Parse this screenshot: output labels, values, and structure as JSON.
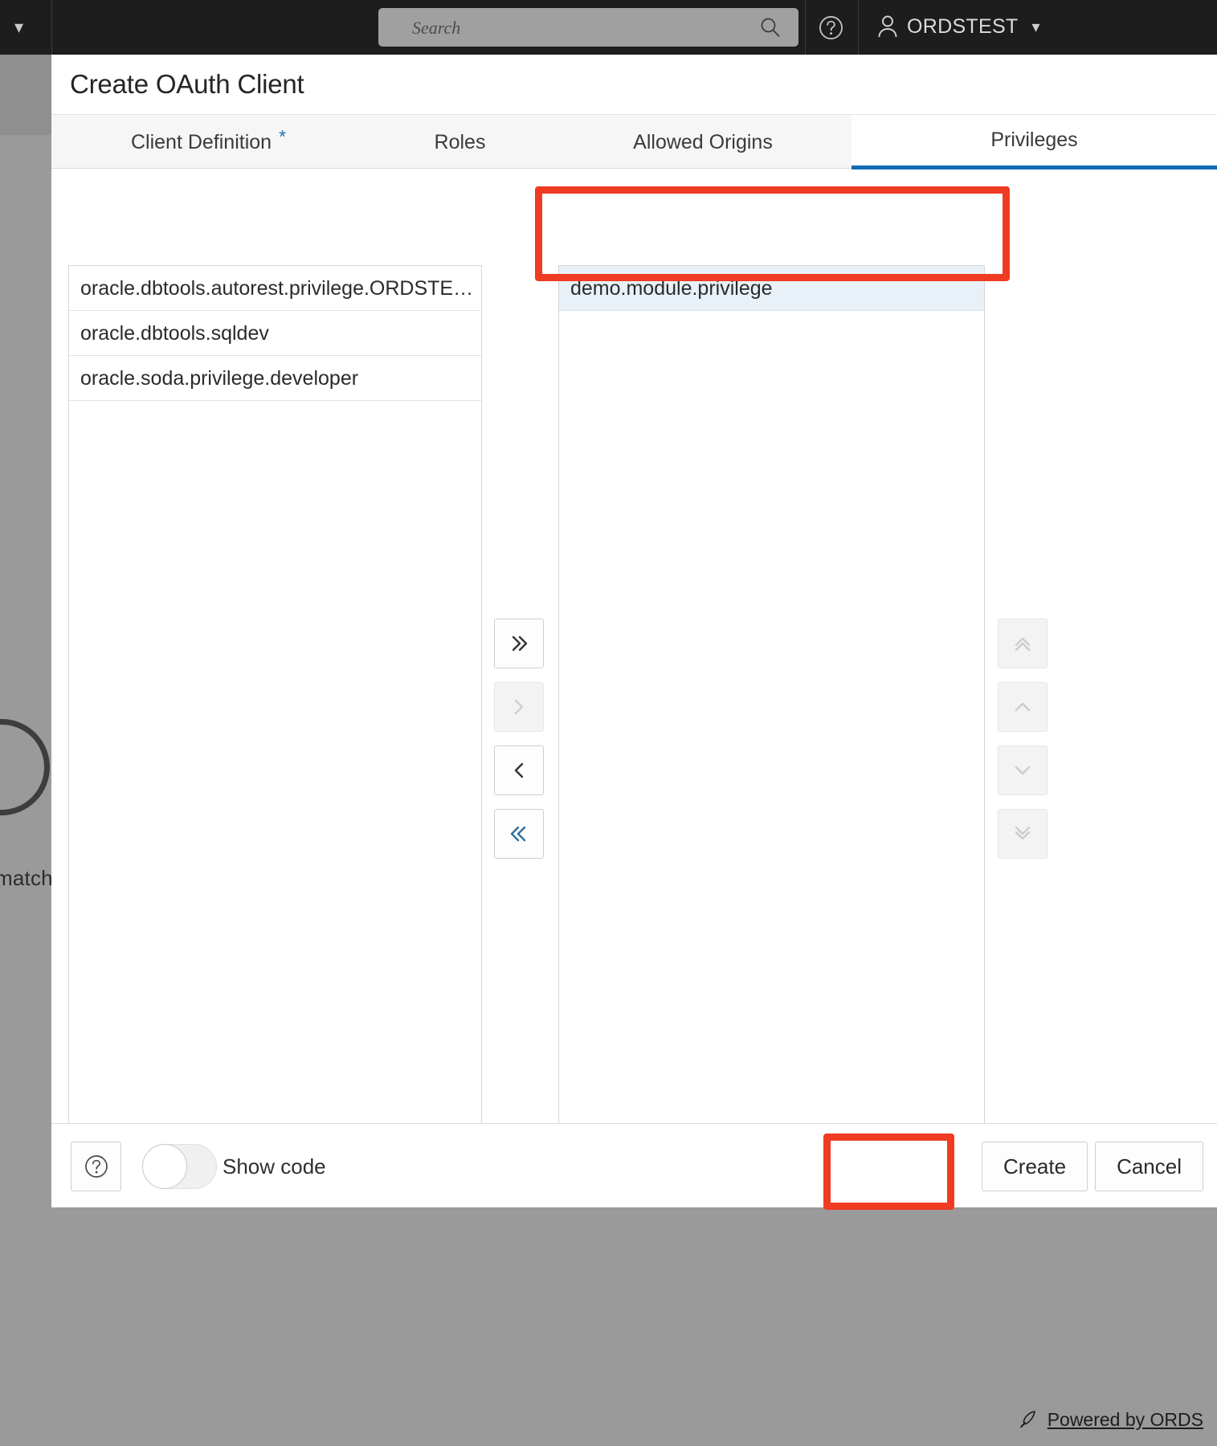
{
  "topbar": {
    "search_placeholder": "Search",
    "search_value": "",
    "help_icon": "help-circle-icon",
    "user_icon": "user-icon",
    "user_name": "ORDSTEST",
    "user_chevron": "chevron-down-icon",
    "left_chevron": "chevron-down-icon"
  },
  "background": {
    "partial_text": "match"
  },
  "modal": {
    "title": "Create OAuth Client",
    "tabs": [
      {
        "label": "Client Definition",
        "required_marker": "*",
        "active": false
      },
      {
        "label": "Roles",
        "required_marker": "",
        "active": false
      },
      {
        "label": "Allowed Origins",
        "required_marker": "",
        "active": false
      },
      {
        "label": "Privileges",
        "required_marker": "",
        "active": true
      }
    ],
    "available_list": {
      "items": [
        {
          "label": "oracle.dbtools.autorest.privilege.ORDSTE…",
          "selected": false
        },
        {
          "label": "oracle.dbtools.sqldev",
          "selected": false
        },
        {
          "label": "oracle.soda.privilege.developer",
          "selected": false
        }
      ]
    },
    "selected_list": {
      "items": [
        {
          "label": "demo.module.privilege",
          "selected": true
        }
      ]
    },
    "transfer_buttons": [
      {
        "name": "move-all-right-button",
        "glyph": "double-chevron-right-icon",
        "disabled": false,
        "accent": "dark"
      },
      {
        "name": "move-right-button",
        "glyph": "chevron-right-icon",
        "disabled": true,
        "accent": "muted"
      },
      {
        "name": "move-left-button",
        "glyph": "chevron-left-icon",
        "disabled": false,
        "accent": "dark"
      },
      {
        "name": "move-all-left-button",
        "glyph": "double-chevron-left-icon",
        "disabled": false,
        "accent": "blue"
      }
    ],
    "reorder_buttons": [
      {
        "name": "move-to-top-button",
        "glyph": "double-chevron-up-icon",
        "disabled": true
      },
      {
        "name": "move-up-button",
        "glyph": "chevron-up-icon",
        "disabled": true
      },
      {
        "name": "move-down-button",
        "glyph": "chevron-down-icon",
        "disabled": true
      },
      {
        "name": "move-to-bottom-button",
        "glyph": "double-chevron-down-icon",
        "disabled": true
      }
    ],
    "footer": {
      "help_icon": "help-circle-icon",
      "show_code_label": "Show code",
      "show_code_on": false,
      "create_label": "Create",
      "cancel_label": "Cancel"
    }
  },
  "page_footer": {
    "rocket_icon": "rocket-icon",
    "powered_by": "Powered by ORDS"
  },
  "colors": {
    "accent_blue": "#136bb3",
    "annotation_red": "#ef3b21",
    "selected_row": "#e8f1f8",
    "topbar_bg": "#1d1d1d",
    "page_bg": "#9a9a9a"
  }
}
